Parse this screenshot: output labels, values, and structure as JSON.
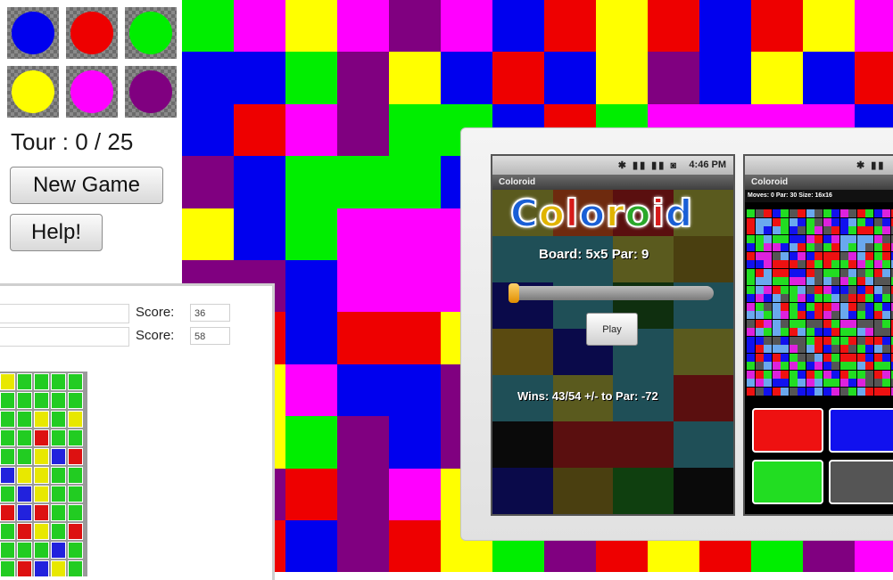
{
  "colors": {
    "blue": "#0000ee",
    "red": "#ee0000",
    "green": "#00ee00",
    "yellow": "#ffff00",
    "magenta": "#ff00ff",
    "purple": "#800080"
  },
  "palette": [
    {
      "name": "blue-color-button",
      "color": "#0000ee"
    },
    {
      "name": "red-color-button",
      "color": "#ee0000"
    },
    {
      "name": "green-color-button",
      "color": "#00ee00"
    },
    {
      "name": "yellow-color-button",
      "color": "#ffff00"
    },
    {
      "name": "magenta-color-button",
      "color": "#ff00ff"
    },
    {
      "name": "purple-color-button",
      "color": "#800080"
    }
  ],
  "status": {
    "tour": "Tour : 0 / 25"
  },
  "buttons": {
    "new_game": "New Game",
    "help": "Help!"
  },
  "board": {
    "columns": 14,
    "rows": 11,
    "cells": [
      "GMYMPMBRYRBRYM",
      "BBGPYBRBYPBYBR",
      "BRMPGGBRGMMMMB",
      "PBGGGBRBGMMGGM",
      "YBGMMMMMMMMGRR",
      "PPBMMMPMMMMRYG",
      "BRBRRYPMMMMMBB",
      "RYMBBPRMMMMRGM",
      "GYGPBPYMMMMMRB",
      "BPRPMYMMMMMMYB",
      "GRBPRYGPRYRGPM"
    ]
  },
  "score_window": {
    "score_label_1": "Score:",
    "score_value_1": "36",
    "score_label_2": "Score:",
    "score_value_2": "58",
    "grid": [
      "YGGGG",
      "GGGGG",
      "GGYGY",
      "GGRGG",
      "GGYBR",
      "BYYGG",
      "GBYGG",
      "RBRGG",
      "GRYGR",
      "GGGBG",
      "GRBYG"
    ]
  },
  "phone1": {
    "status_time": "4:46 PM",
    "status_icons": "✱ ▮▮ ▮▮ ◙",
    "app_title": "Coloroid",
    "logo_letters": [
      {
        "ch": "C",
        "color": "#1a5fd6"
      },
      {
        "ch": "o",
        "color": "#e0b400"
      },
      {
        "ch": "l",
        "color": "#d61a1a"
      },
      {
        "ch": "o",
        "color": "#1a5fd6"
      },
      {
        "ch": "r",
        "color": "#e0b400"
      },
      {
        "ch": "o",
        "color": "#2aa82a"
      },
      {
        "ch": "i",
        "color": "#d61a1a"
      },
      {
        "ch": "d",
        "color": "#1a5fd6"
      }
    ],
    "board_info": "Board: 5x5   Par: 9",
    "play_label": "Play",
    "wins_info": "Wins: 43/54   +/- to Par: -72",
    "bg_rows": [
      [
        "#5a5a1e",
        "#6e2a0e",
        "#5a0f0f",
        "#5a5a1e"
      ],
      [
        "#1f4f57",
        "#1f4f57",
        "#5a5a1e",
        "#4a3f10"
      ],
      [
        "#0a0a4a",
        "#1f4f57",
        "#0f2f0f",
        "#1f4f57"
      ],
      [
        "#5a4a10",
        "#0a0a4a",
        "#1f4f57",
        "#5a5a1e"
      ],
      [
        "#1f4f57",
        "#5a5a1e",
        "#1f4f57",
        "#5a0f0f"
      ],
      [
        "#0a0a0a",
        "#5a0f0f",
        "#5a0f0f",
        "#1f4f57"
      ],
      [
        "#0a0a4a",
        "#4a3f10",
        "#0f3f0f",
        "#0a0a0a"
      ]
    ]
  },
  "phone2": {
    "app_title": "Coloroid",
    "stats": "Moves: 0    Par: 30    Size: 16x16",
    "status_icons": "✱ ▮▮",
    "buttons": [
      {
        "name": "red-choice-button",
        "color": "#ee1111"
      },
      {
        "name": "blue-choice-button",
        "color": "#1111ee"
      },
      {
        "name": "green-choice-button",
        "color": "#22dd22"
      },
      {
        "name": "gray-choice-button",
        "color": "#555555"
      }
    ]
  }
}
